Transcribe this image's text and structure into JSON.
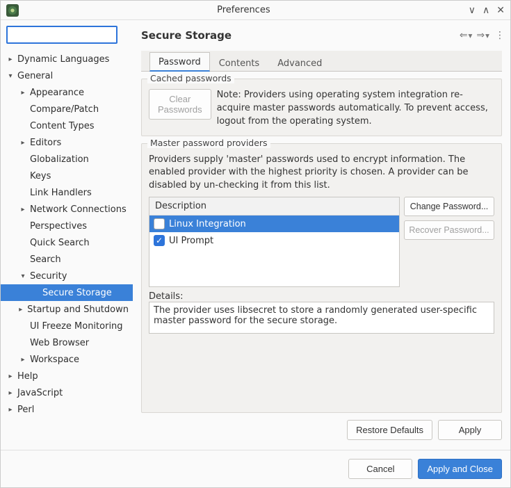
{
  "window": {
    "title": "Preferences"
  },
  "header": {
    "title": "Secure Storage"
  },
  "filter": {
    "value": "",
    "placeholder": ""
  },
  "tree": {
    "items": [
      {
        "label": "Dynamic Languages",
        "level": 0,
        "expander": "closed"
      },
      {
        "label": "General",
        "level": 0,
        "expander": "open"
      },
      {
        "label": "Appearance",
        "level": 1,
        "expander": "closed"
      },
      {
        "label": "Compare/Patch",
        "level": 1,
        "expander": "none"
      },
      {
        "label": "Content Types",
        "level": 1,
        "expander": "none"
      },
      {
        "label": "Editors",
        "level": 1,
        "expander": "closed"
      },
      {
        "label": "Globalization",
        "level": 1,
        "expander": "none"
      },
      {
        "label": "Keys",
        "level": 1,
        "expander": "none"
      },
      {
        "label": "Link Handlers",
        "level": 1,
        "expander": "none"
      },
      {
        "label": "Network Connections",
        "level": 1,
        "expander": "closed"
      },
      {
        "label": "Perspectives",
        "level": 1,
        "expander": "none"
      },
      {
        "label": "Quick Search",
        "level": 1,
        "expander": "none"
      },
      {
        "label": "Search",
        "level": 1,
        "expander": "none"
      },
      {
        "label": "Security",
        "level": 1,
        "expander": "open"
      },
      {
        "label": "Secure Storage",
        "level": 2,
        "expander": "none",
        "selected": true
      },
      {
        "label": "Startup and Shutdown",
        "level": 1,
        "expander": "closed"
      },
      {
        "label": "UI Freeze Monitoring",
        "level": 1,
        "expander": "none"
      },
      {
        "label": "Web Browser",
        "level": 1,
        "expander": "none"
      },
      {
        "label": "Workspace",
        "level": 1,
        "expander": "closed"
      },
      {
        "label": "Help",
        "level": 0,
        "expander": "closed"
      },
      {
        "label": "JavaScript",
        "level": 0,
        "expander": "closed"
      },
      {
        "label": "Perl",
        "level": 0,
        "expander": "closed"
      }
    ]
  },
  "tabs": [
    {
      "label": "Password",
      "active": true
    },
    {
      "label": "Contents",
      "active": false
    },
    {
      "label": "Advanced",
      "active": false
    }
  ],
  "cached": {
    "legend": "Cached passwords",
    "clear_btn": "Clear Passwords",
    "note": "Note: Providers using operating system integration re-acquire master passwords automatically. To prevent access, logout from the operating system."
  },
  "providers": {
    "legend": "Master password providers",
    "intro": "Providers supply 'master' passwords used to encrypt information. The enabled provider with the highest priority is chosen. A provider can be disabled by un-checking it from this list.",
    "col_header": "Description",
    "rows": [
      {
        "label": "Linux Integration",
        "checked": false,
        "selected": true
      },
      {
        "label": "UI Prompt",
        "checked": true,
        "selected": false
      }
    ],
    "change_btn": "Change Password...",
    "recover_btn": "Recover Password...",
    "details_label": "Details:",
    "details_text": "The provider uses libsecret to store a randomly generated user-specific master password for the secure storage."
  },
  "page_buttons": {
    "restore": "Restore Defaults",
    "apply": "Apply"
  },
  "footer_buttons": {
    "cancel": "Cancel",
    "apply_close": "Apply and Close"
  }
}
